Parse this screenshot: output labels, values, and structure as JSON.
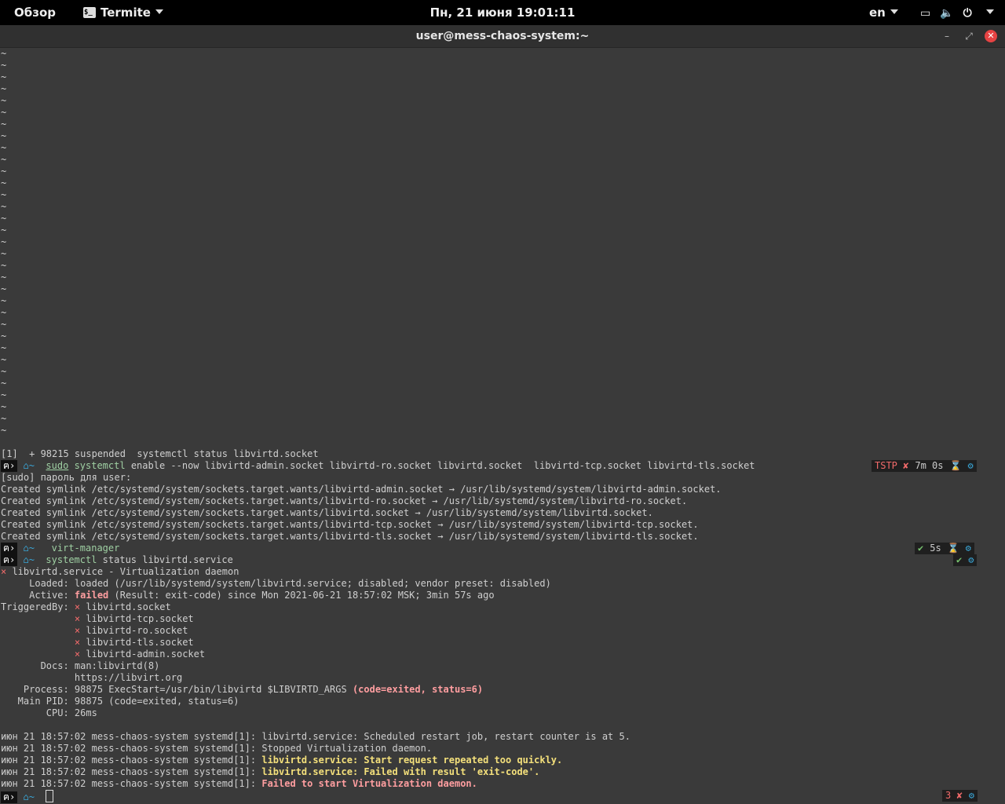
{
  "topbar": {
    "activities": "Обзор",
    "app_name": "Termite",
    "clock": "Пн, 21 июня  19:01:11",
    "lang": "en"
  },
  "window": {
    "title": "user@mess-chaos-system:~",
    "minimize": "–",
    "maximize": "⤢",
    "close": "✕"
  },
  "terminal": {
    "tilde": "~",
    "job_line": "[1]  + 98215 suspended  systemctl status libvirtd.socket",
    "cmd1": {
      "sudo": "sudo",
      "bin": "systemctl",
      "args": " enable --now libvirtd-admin.socket libvirtd-ro.socket libvirtd.socket  libvirtd-tcp.socket libvirtd-tls.socket"
    },
    "sudo_prompt": "[sudo] пароль для user:",
    "symlinks": [
      "Created symlink /etc/systemd/system/sockets.target.wants/libvirtd-admin.socket → /usr/lib/systemd/system/libvirtd-admin.socket.",
      "Created symlink /etc/systemd/system/sockets.target.wants/libvirtd-ro.socket → /usr/lib/systemd/system/libvirtd-ro.socket.",
      "Created symlink /etc/systemd/system/sockets.target.wants/libvirtd.socket → /usr/lib/systemd/system/libvirtd.socket.",
      "Created symlink /etc/systemd/system/sockets.target.wants/libvirtd-tcp.socket → /usr/lib/systemd/system/libvirtd-tcp.socket.",
      "Created symlink /etc/systemd/system/sockets.target.wants/libvirtd-tls.socket → /usr/lib/systemd/system/libvirtd-tls.socket."
    ],
    "cmd2": " virt-manager",
    "cmd3": {
      "bin": "systemctl",
      "args": " status libvirtd.service"
    },
    "prompt_dir": "~",
    "status": {
      "header_x": "×",
      "header": " libvirtd.service - Virtualization daemon",
      "loaded": "     Loaded: loaded (/usr/lib/systemd/system/libvirtd.service; disabled; vendor preset: disabled)",
      "active_label": "     Active: ",
      "active_state": "failed",
      "active_rest": " (Result: exit-code) since Mon 2021-06-21 18:57:02 MSK; 3min 57s ago",
      "triggered_label": "TriggeredBy: ",
      "indent": "             ",
      "triggers": [
        "libvirtd.socket",
        "libvirtd-tcp.socket",
        "libvirtd-ro.socket",
        "libvirtd-tls.socket",
        "libvirtd-admin.socket"
      ],
      "docs": "       Docs: man:libvirtd(8)",
      "docs2": "             https://libvirt.org",
      "process": "    Process: 98875 ExecStart=/usr/bin/libvirtd $LIBVIRTD_ARGS ",
      "process_code": "(code=exited, status=6)",
      "mainpid": "   Main PID: 98875 (code=exited, status=6)",
      "cpu": "        CPU: 26ms"
    },
    "journal": [
      {
        "prefix": "июн 21 18:57:02 mess-chaos-system systemd[1]: ",
        "msg": "libvirtd.service: Scheduled restart job, restart counter is at 5.",
        "style": "normal"
      },
      {
        "prefix": "июн 21 18:57:02 mess-chaos-system systemd[1]: ",
        "msg": "Stopped Virtualization daemon.",
        "style": "normal"
      },
      {
        "prefix": "июн 21 18:57:02 mess-chaos-system systemd[1]: ",
        "msg": "libvirtd.service: Start request repeated too quickly.",
        "style": "warn"
      },
      {
        "prefix": "июн 21 18:57:02 mess-chaos-system systemd[1]: ",
        "msg": "libvirtd.service: Failed with result 'exit-code'.",
        "style": "warn"
      },
      {
        "prefix": "июн 21 18:57:02 mess-chaos-system systemd[1]: ",
        "msg": "Failed to start Virtualization daemon.",
        "style": "err"
      }
    ],
    "rprompts": {
      "r1": {
        "status": "TSTP ✘",
        "time": "7m 0s"
      },
      "r2": {
        "status": "✔",
        "time": "5s"
      },
      "r3": {
        "status": "✔"
      },
      "r4": {
        "status": "3 ✘"
      }
    }
  },
  "colors": {
    "terminal_bg": "#3a3a3a",
    "accent_blue": "#39a7d8",
    "error_red": "#f26b6b"
  }
}
